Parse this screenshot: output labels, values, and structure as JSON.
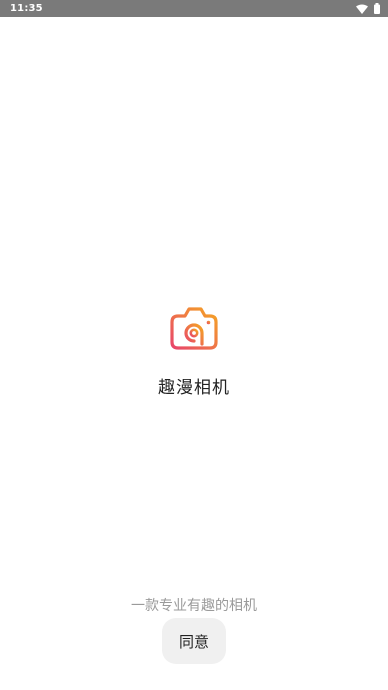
{
  "status_bar": {
    "time": "11:35",
    "icons": [
      "wifi-icon",
      "battery-icon"
    ]
  },
  "app": {
    "logo_icon": "camera-logo-icon",
    "name": "趣漫相机",
    "tagline": "一款专业有趣的相机",
    "agree_label": "同意"
  },
  "colors": {
    "status_bar_bg": "#7a7a7a",
    "logo_gradient_start": "#f5a623",
    "logo_gradient_end": "#e8456b",
    "button_bg": "#f0f0f0"
  }
}
